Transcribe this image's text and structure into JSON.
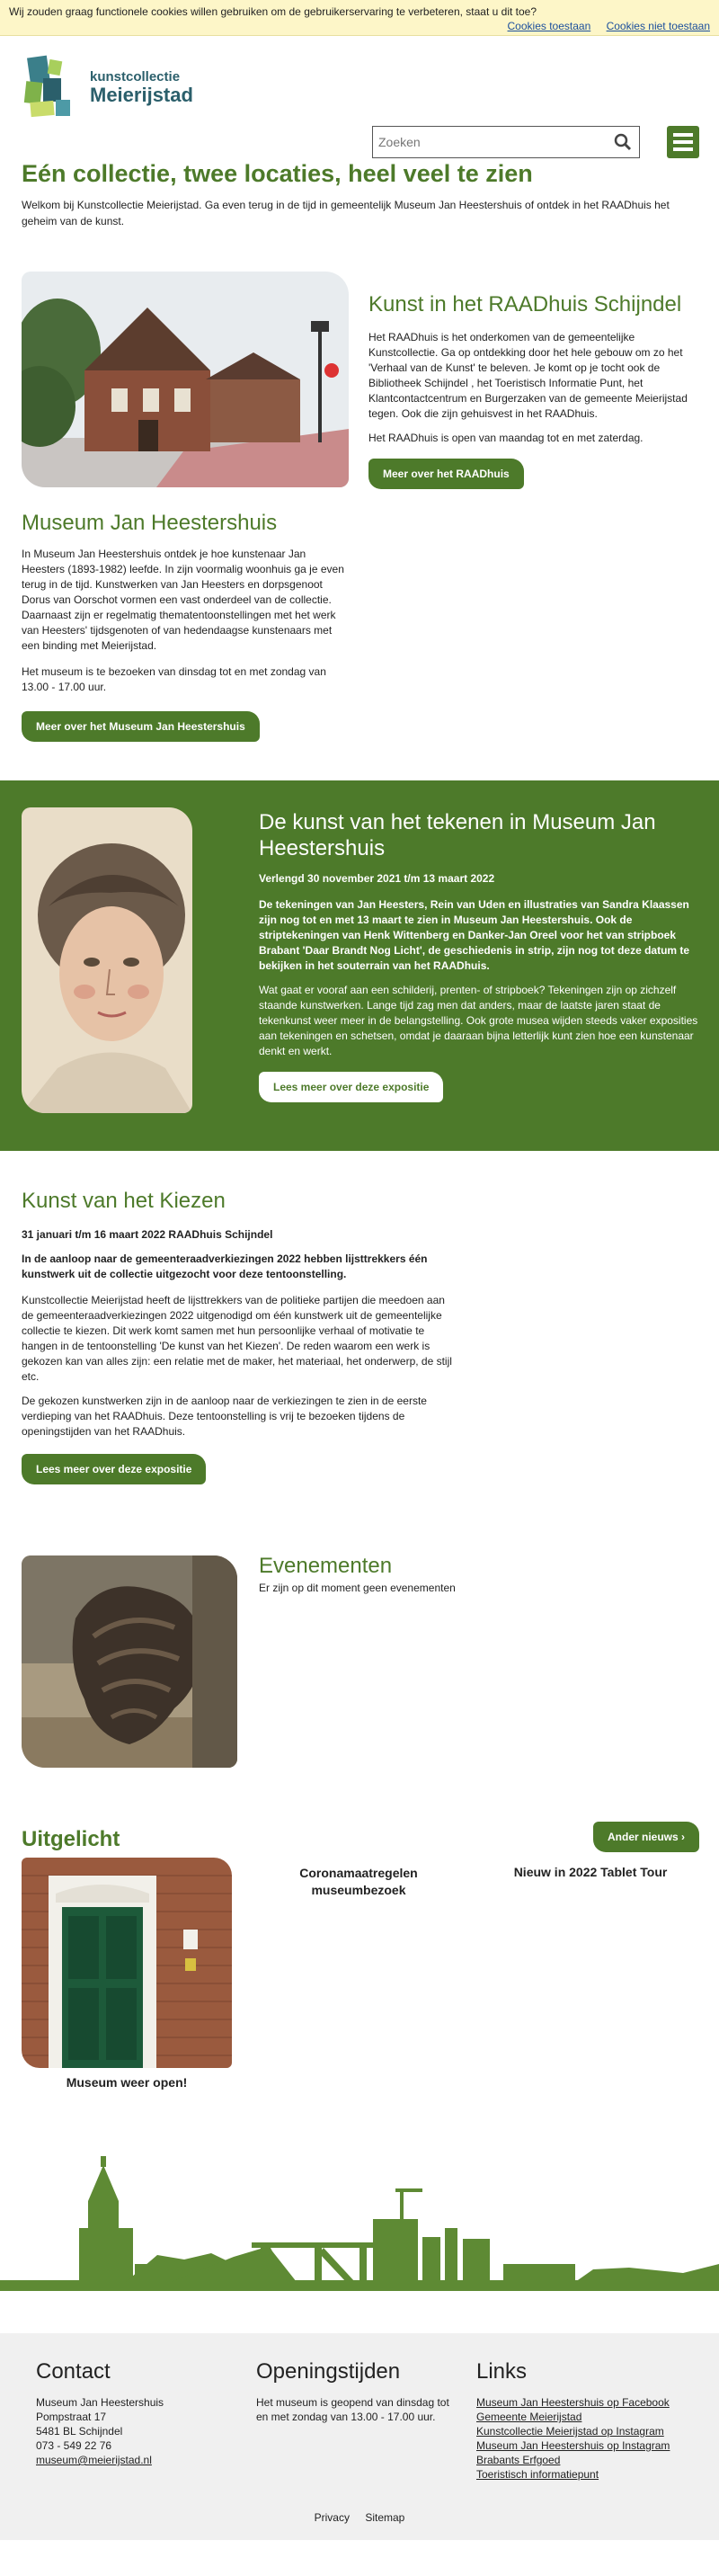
{
  "cookie": {
    "message": "Wij zouden graag functionele cookies willen gebruiken om de gebruikerservaring te verbeteren, staat u dit toe?",
    "accept": "Cookies toestaan",
    "decline": "Cookies niet toestaan"
  },
  "logo": {
    "line1": "kunstcollectie",
    "line2": "Meierijstad"
  },
  "search": {
    "placeholder": "Zoeken"
  },
  "intro": {
    "title": "Eén collectie, twee locaties, heel veel te zien",
    "text": "Welkom bij Kunstcollectie Meierijstad. Ga even terug in de tijd in gemeentelijk Museum Jan Heestershuis of ontdek in het RAADhuis het geheim van de kunst."
  },
  "raadhuis": {
    "title": "Kunst in het RAADhuis Schijndel",
    "p1": "Het RAADhuis is het onderkomen van de gemeentelijke Kunstcollectie. Ga op ontdekking door het hele gebouw om zo het  'Verhaal van de Kunst' te beleven. Je komt op je tocht ook de Bibliotheek Schijndel , het Toeristisch Informatie Punt, het Klantcontactcentrum en Burgerzaken van de gemeente Meierijstad tegen. Ook die zijn gehuisvest in het RAADhuis.",
    "p2": "Het RAADhuis is open van maandag tot en met zaterdag.",
    "button": "Meer over het RAADhuis"
  },
  "museum": {
    "title": "Museum Jan Heestershuis",
    "p1": "In Museum Jan Heestershuis ontdek je hoe kunstenaar Jan Heesters (1893-1982) leefde. In zijn voormalig woonhuis ga je even terug in de tijd. Kunstwerken van Jan Heesters en dorpsgenoot Dorus van Oorschot vormen een vast onderdeel van de collectie. Daarnaast zijn er regelmatig thematentoonstellingen met het werk van Heesters' tijdsgenoten of van hedendaagse kunstenaars met een binding met Meierijstad.",
    "p2": "Het museum is te bezoeken van dinsdag tot en met zondag van 13.00 - 17.00 uur.",
    "button": "Meer over het Museum Jan Heestershuis"
  },
  "tekenen": {
    "title": "De kunst van het tekenen in Museum Jan Heestershuis",
    "date": "Verlengd 30 november 2021 t/m 13 maart 2022",
    "p1": "De tekeningen van Jan Heesters, Rein van Uden en illustraties van Sandra Klaassen zijn nog tot en met 13 maart te zien in Museum Jan Heestershuis. Ook de striptekeningen van Henk Wittenberg en Danker-Jan Oreel voor het van stripboek Brabant 'Daar Brandt Nog Licht', de geschiedenis in strip, zijn nog tot deze datum te bekijken in het souterrain van het RAADhuis.",
    "p2": "Wat gaat er vooraf aan een schilderij, prenten- of stripboek? Tekeningen zijn op zichzelf staande kunstwerken. Lange tijd zag men dat anders, maar de laatste jaren staat de tekenkunst weer meer in de belangstelling. Ook grote musea wijden steeds vaker exposities aan tekeningen en schetsen, omdat je daaraan bijna letterlijk kunt zien hoe een kunstenaar denkt en werkt.",
    "button": "Lees meer over deze expositie"
  },
  "kiezen": {
    "title": "Kunst van het Kiezen",
    "date": "31 januari t/m 16 maart 2022 RAADhuis Schijndel",
    "lead": "In de aanloop naar de gemeenteraadverkiezingen 2022 hebben lijsttrekkers één kunstwerk uit de collectie uitgezocht voor deze tentoonstelling.",
    "p1": "Kunstcollectie Meierijstad heeft de lijsttrekkers van de politieke partijen die meedoen aan de gemeenteraadverkiezingen 2022 uitgenodigd om één kunstwerk uit de gemeentelijke collectie te kiezen.  Dit werk komt samen met hun persoonlijke verhaal of motivatie te hangen in de tentoonstelling 'De kunst van het Kiezen'. De reden waarom een werk is gekozen kan van alles zijn: een relatie met de maker, het materiaal, het onderwerp, de stijl etc.",
    "p2": "De gekozen kunstwerken zijn in de aanloop naar de verkiezingen te zien in de eerste verdieping van het RAADhuis. Deze tentoonstelling is vrij te bezoeken tijdens de openingstijden van het RAADhuis.",
    "button": "Lees meer over deze expositie"
  },
  "events": {
    "title": "Evenementen",
    "empty": "Er zijn op dit moment geen evenementen"
  },
  "uitgelicht": {
    "title": "Uitgelicht",
    "more_button": "Ander nieuws ›",
    "items": [
      {
        "title": "Museum weer open!"
      },
      {
        "title": "Coronamaatregelen museumbezoek"
      },
      {
        "title": "Nieuw in 2022 Tablet Tour"
      }
    ]
  },
  "footer": {
    "contact": {
      "title": "Contact",
      "lines": [
        "Museum Jan Heestershuis",
        "Pompstraat 17",
        "5481 BL Schijndel",
        "073 - 549 22 76"
      ],
      "email": "museum@meierijstad.nl"
    },
    "hours": {
      "title": "Openingstijden",
      "text": "Het museum is geopend van dinsdag tot en met zondag van 13.00 - 17.00 uur."
    },
    "links": {
      "title": "Links",
      "items": [
        "Museum Jan Heestershuis op Facebook",
        "Gemeente Meierijstad",
        "Kunstcollectie Meierijstad op Instagram",
        "Museum Jan Heestershuis op Instagram",
        "Brabants Erfgoed",
        "Toeristisch informatiepunt"
      ]
    },
    "bottom": {
      "privacy": "Privacy",
      "sitemap": "Sitemap"
    }
  },
  "colors": {
    "brand_green": "#4d7a2a",
    "cookie_bg": "#fdf6c8",
    "link_blue": "#1b4f9c",
    "footer_bg": "#f0f0f0"
  }
}
